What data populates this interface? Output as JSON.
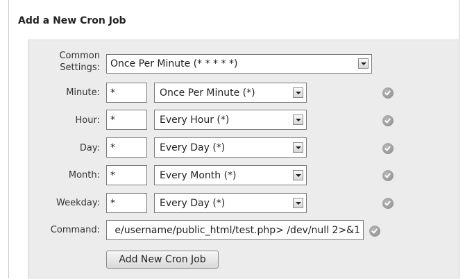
{
  "form": {
    "title": "Add a New Cron Job",
    "common_settings": {
      "label_line1": "Common",
      "label_line2": "Settings:",
      "selected": "Once Per Minute (* * * * *)"
    },
    "fields": [
      {
        "label": "Minute:",
        "value": "*",
        "selected": "Once Per Minute (*)"
      },
      {
        "label": "Hour:",
        "value": "*",
        "selected": "Every Hour (*)"
      },
      {
        "label": "Day:",
        "value": "*",
        "selected": "Every Day (*)"
      },
      {
        "label": "Month:",
        "value": "*",
        "selected": "Every Month (*)"
      },
      {
        "label": "Weekday:",
        "value": "*",
        "selected": "Every Day (*)"
      }
    ],
    "command": {
      "label": "Command:",
      "value": "e/username/public_html/test.php> /dev/null 2>&1"
    },
    "submit_label": "Add New Cron Job"
  }
}
